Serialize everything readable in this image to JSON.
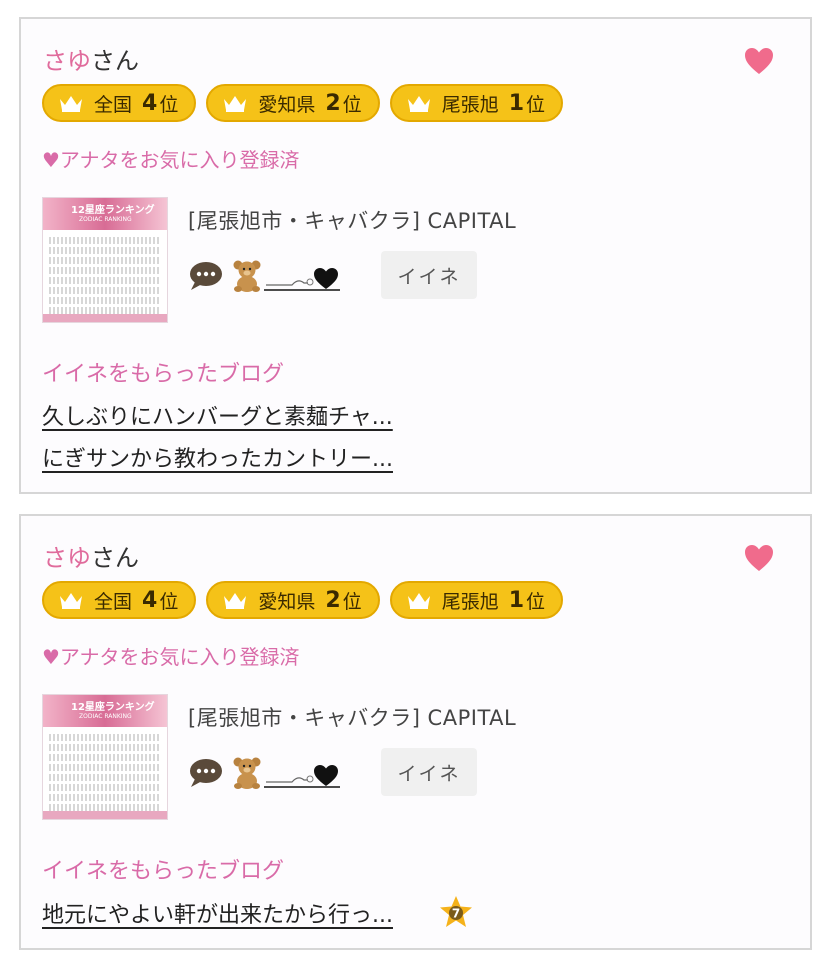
{
  "cards": [
    {
      "user_name": "さゆ",
      "name_suffix": "さん",
      "ranks": [
        {
          "area": "全国",
          "rank": "4",
          "suffix": "位"
        },
        {
          "area": "愛知県",
          "rank": "2",
          "suffix": "位"
        },
        {
          "area": "尾張旭",
          "rank": "1",
          "suffix": "位"
        }
      ],
      "favorite_status": "♥アナタをお気に入り登録済",
      "shop": "[尾張旭市・キャバクラ]  CAPITAL",
      "thumb_title": "12星座ランキング",
      "thumb_sub": "ZODIAC RANKING",
      "iine_button": "イイネ",
      "blog_heading": "イイネをもらったブログ",
      "blog_links": [
        "久しぶりにハンバーグと素麺チャ...",
        "にぎサンから教わったカントリー..."
      ]
    },
    {
      "user_name": "さゆ",
      "name_suffix": "さん",
      "ranks": [
        {
          "area": "全国",
          "rank": "4",
          "suffix": "位"
        },
        {
          "area": "愛知県",
          "rank": "2",
          "suffix": "位"
        },
        {
          "area": "尾張旭",
          "rank": "1",
          "suffix": "位"
        }
      ],
      "favorite_status": "♥アナタをお気に入り登録済",
      "shop": "[尾張旭市・キャバクラ]  CAPITAL",
      "thumb_title": "12星座ランキング",
      "thumb_sub": "ZODIAC RANKING",
      "iine_button": "イイネ",
      "blog_heading": "イイネをもらったブログ",
      "blog_links": [
        "地元にやよい軒が出来たから行っ..."
      ],
      "badge_number": "7"
    }
  ],
  "icons": [
    "heart-icon",
    "crown-icon",
    "speech-bubble-icon",
    "teddy-bear-icon",
    "black-heart-icon",
    "star-badge-icon"
  ],
  "colors": {
    "pink": "#e06b9c",
    "badge_yellow": "#f5c218",
    "heart": "#f06b8c"
  }
}
